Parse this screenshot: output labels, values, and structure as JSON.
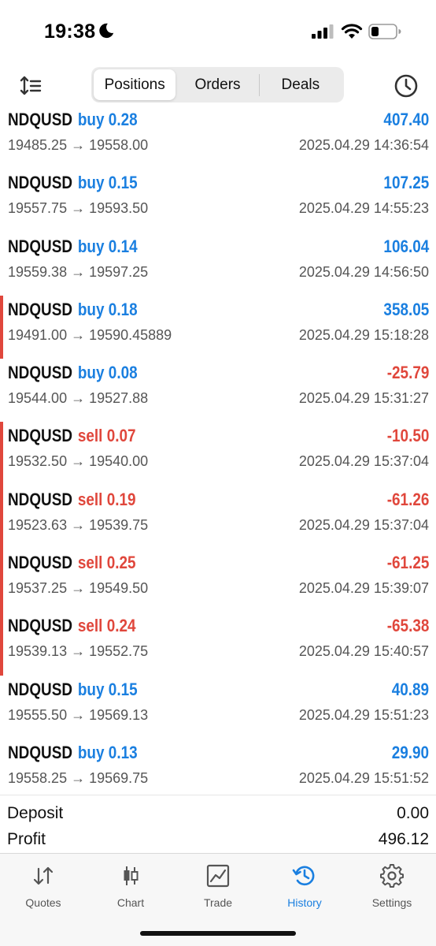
{
  "status_bar": {
    "time": "19:38"
  },
  "header": {
    "segments": [
      {
        "label": "Positions",
        "active": true
      },
      {
        "label": "Orders",
        "active": false
      },
      {
        "label": "Deals",
        "active": false
      }
    ]
  },
  "positions": [
    {
      "symbol": "NDQUSD",
      "side": "buy",
      "volume": "0.28",
      "prices": "19485.25 → 19558.00",
      "time": "2025.04.29 14:36:54",
      "profit": "407.40"
    },
    {
      "symbol": "NDQUSD",
      "side": "buy",
      "volume": "0.15",
      "prices": "19557.75 → 19593.50",
      "time": "2025.04.29 14:55:23",
      "profit": "107.25"
    },
    {
      "symbol": "NDQUSD",
      "side": "buy",
      "volume": "0.14",
      "prices": "19559.38 → 19597.25",
      "time": "2025.04.29 14:56:50",
      "profit": "106.04"
    },
    {
      "symbol": "NDQUSD",
      "side": "buy",
      "volume": "0.18",
      "prices": "19491.00 → 19590.45889",
      "time": "2025.04.29 15:18:28",
      "profit": "358.05"
    },
    {
      "symbol": "NDQUSD",
      "side": "buy",
      "volume": "0.08",
      "prices": "19544.00 → 19527.88",
      "time": "2025.04.29 15:31:27",
      "profit": "-25.79"
    },
    {
      "symbol": "NDQUSD",
      "side": "sell",
      "volume": "0.07",
      "prices": "19532.50 → 19540.00",
      "time": "2025.04.29 15:37:04",
      "profit": "-10.50"
    },
    {
      "symbol": "NDQUSD",
      "side": "sell",
      "volume": "0.19",
      "prices": "19523.63 → 19539.75",
      "time": "2025.04.29 15:37:04",
      "profit": "-61.26"
    },
    {
      "symbol": "NDQUSD",
      "side": "sell",
      "volume": "0.25",
      "prices": "19537.25 → 19549.50",
      "time": "2025.04.29 15:39:07",
      "profit": "-61.25"
    },
    {
      "symbol": "NDQUSD",
      "side": "sell",
      "volume": "0.24",
      "prices": "19539.13 → 19552.75",
      "time": "2025.04.29 15:40:57",
      "profit": "-65.38"
    },
    {
      "symbol": "NDQUSD",
      "side": "buy",
      "volume": "0.15",
      "prices": "19555.50 → 19569.13",
      "time": "2025.04.29 15:51:23",
      "profit": "40.89"
    },
    {
      "symbol": "NDQUSD",
      "side": "buy",
      "volume": "0.13",
      "prices": "19558.25 → 19569.75",
      "time": "2025.04.29 15:51:52",
      "profit": "29.90"
    }
  ],
  "summary": {
    "deposit_label": "Deposit",
    "deposit_value": "0.00",
    "profit_label": "Profit",
    "profit_value": "496.12"
  },
  "tabs": [
    {
      "label": "Quotes",
      "icon": "quotes-arrows-icon",
      "active": false
    },
    {
      "label": "Chart",
      "icon": "candlestick-icon",
      "active": false
    },
    {
      "label": "Trade",
      "icon": "trade-chart-icon",
      "active": false
    },
    {
      "label": "History",
      "icon": "history-clock-icon",
      "active": true
    },
    {
      "label": "Settings",
      "icon": "gear-icon",
      "active": false
    }
  ],
  "colors": {
    "buy": "#1a7fe0",
    "sell": "#e0473c",
    "accent": "#1a7fe0"
  }
}
